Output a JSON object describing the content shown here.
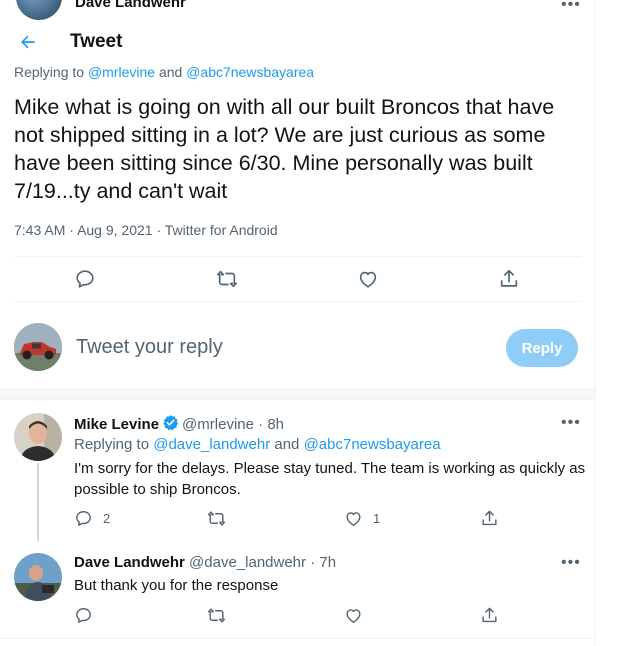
{
  "clipped_header": {
    "name": "Dave Landwehr"
  },
  "nav": {
    "title": "Tweet"
  },
  "main_tweet": {
    "replying_prefix": "Replying to",
    "replying_to": [
      "@mrlevine",
      "@abc7newsbayarea"
    ],
    "and": "and",
    "text": "Mike what is going on with all our built Broncos that have not shipped sitting in a lot? We are just curious as some have been sitting since 6/30. Mine personally was built 7/19...ty and can't wait",
    "time": "7:43 AM",
    "date": "Aug 9, 2021",
    "source": "Twitter for Android",
    "separator": "·"
  },
  "composer": {
    "placeholder": "Tweet your reply",
    "button_label": "Reply"
  },
  "replies": [
    {
      "name": "Mike Levine",
      "handle": "@mrlevine",
      "age": "8h",
      "verified": true,
      "replying_prefix": "Replying to",
      "replying_to": [
        "@dave_landwehr",
        "@abc7newsbayarea"
      ],
      "and": "and",
      "text": "I'm sorry for the delays. Please stay tuned. The team is working as quickly as possible to ship Broncos.",
      "reply_count": "2",
      "retweet_count": "",
      "like_count": "1"
    },
    {
      "name": "Dave Landwehr",
      "handle": "@dave_landwehr",
      "age": "7h",
      "verified": false,
      "text": "But thank you for the response",
      "reply_count": "",
      "retweet_count": "",
      "like_count": ""
    }
  ],
  "icons": {
    "back": "arrow-left-icon",
    "reply": "speech-bubble-icon",
    "retweet": "retweet-icon",
    "like": "heart-icon",
    "share": "share-icon",
    "more": "more-dots-icon",
    "verified": "verified-badge-icon"
  },
  "colors": {
    "accent": "#1d9bf0",
    "reply_button_disabled": "#8ecdf8",
    "secondary_text": "#536471",
    "primary_text": "#0f1419"
  },
  "more_label": "•••"
}
